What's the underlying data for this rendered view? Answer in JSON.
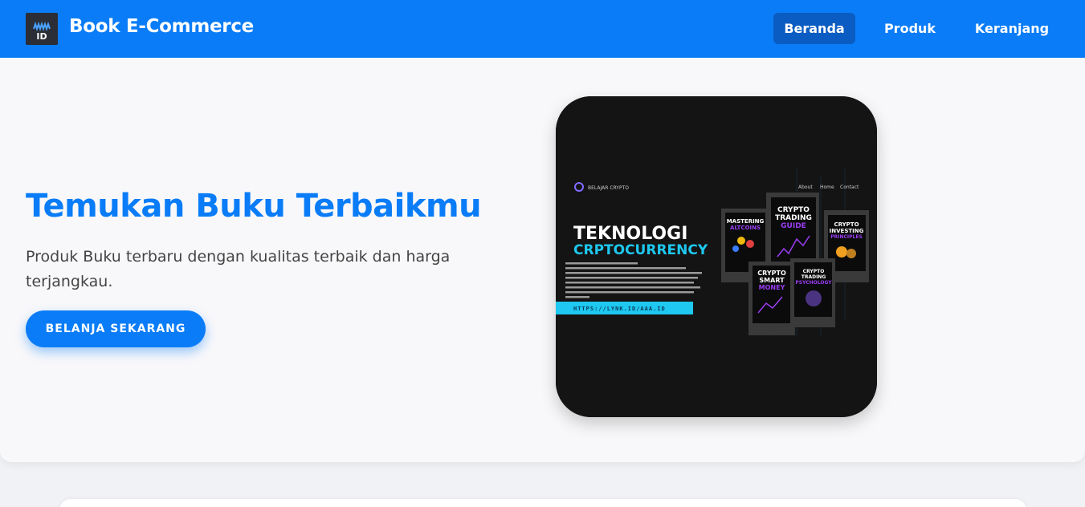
{
  "navbar": {
    "logo_text": "ID",
    "brand": "Book E-Commerce",
    "items": [
      {
        "label": "Beranda",
        "active": true
      },
      {
        "label": "Produk",
        "active": false
      },
      {
        "label": "Keranjang",
        "active": false
      }
    ]
  },
  "hero": {
    "title": "Temukan Buku Terbaikmu",
    "description": "Produk Buku terbaru dengan kualitas terbaik dan harga terjangkau.",
    "cta_label": "BELANJA SEKARANG",
    "image": {
      "site_name": "BELAJAR CRYPTO",
      "nav": [
        "About",
        "Home",
        "Contact"
      ],
      "headline_1": "TEKNOLOGI",
      "headline_2": "CRPTOCURRENCY",
      "url": "HTTPS://LYNK.ID/AAA.ID",
      "books": [
        {
          "l1": "MASTERING",
          "l2": "ALTCOINS"
        },
        {
          "l1": "CRYPTO",
          "l2": "TRADING",
          "l3": "GUIDE"
        },
        {
          "l1": "CRYPTO",
          "l2": "INVESTING",
          "l3": "PRINCIPLES"
        },
        {
          "l1": "CRYPTO",
          "l2": "SMART",
          "l3": "MONEY"
        },
        {
          "l1": "CRYPTO",
          "l2": "TRADING",
          "l3": "PSYCHOLOGY"
        }
      ]
    }
  },
  "colors": {
    "primary": "#0a7cf7",
    "active_nav": "#0a5cc2",
    "accent_cyan": "#1ec8f0",
    "accent_purple": "#9b3df5"
  }
}
